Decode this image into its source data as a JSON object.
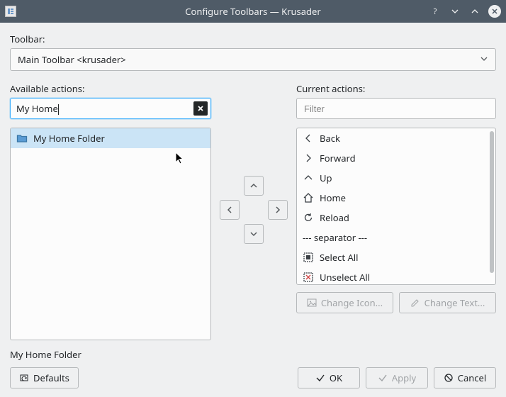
{
  "window": {
    "title": "Configure Toolbars — Krusader"
  },
  "labels": {
    "toolbar": "Toolbar:",
    "available": "Available actions:",
    "current": "Current actions:"
  },
  "toolbar_select": {
    "value": "Main Toolbar <krusader>"
  },
  "available_filter": {
    "value": "My Home"
  },
  "current_filter": {
    "placeholder": "Filter",
    "value": ""
  },
  "available_list": [
    {
      "icon": "folder",
      "label": "My Home Folder",
      "selected": true
    }
  ],
  "current_list": [
    {
      "icon": "back",
      "label": "Back"
    },
    {
      "icon": "forward",
      "label": "Forward"
    },
    {
      "icon": "up",
      "label": "Up"
    },
    {
      "icon": "home",
      "label": "Home"
    },
    {
      "icon": "reload",
      "label": "Reload"
    },
    {
      "separator": true,
      "label": "--- separator ---"
    },
    {
      "icon": "select-all",
      "label": "Select All"
    },
    {
      "icon": "unselect-all",
      "label": "Unselect All"
    }
  ],
  "buttons": {
    "change_icon": "Change Icon...",
    "change_text": "Change Text...",
    "defaults": "Defaults",
    "ok": "OK",
    "apply": "Apply",
    "cancel": "Cancel"
  },
  "status": {
    "text": "My Home Folder"
  }
}
